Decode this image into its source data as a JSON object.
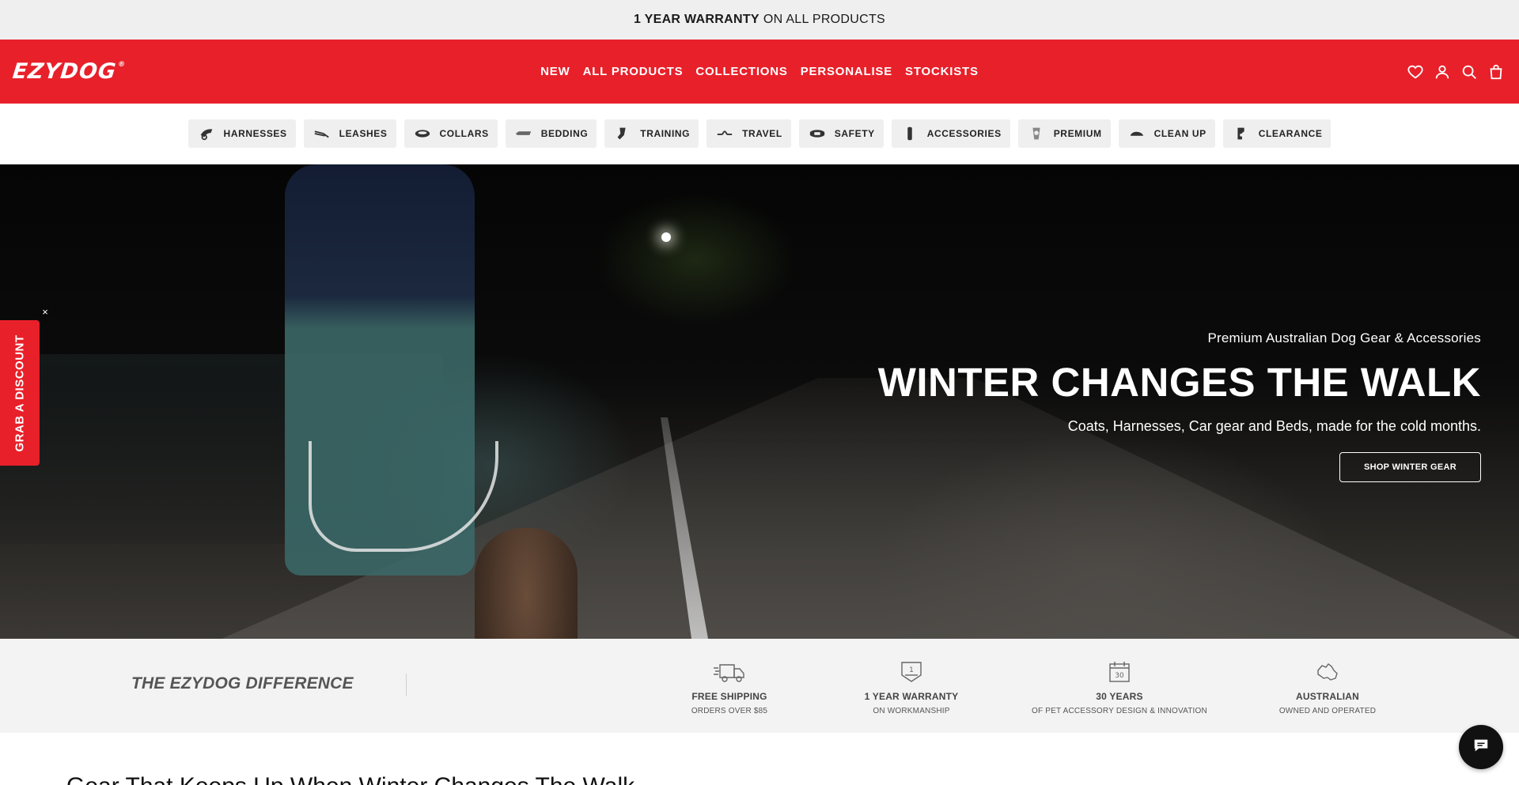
{
  "announcement": {
    "bold": "1 YEAR WARRANTY",
    "rest": "ON ALL PRODUCTS"
  },
  "header": {
    "logo": "EZYDOG",
    "logo_mark": "®",
    "nav": [
      "NEW",
      "ALL PRODUCTS",
      "COLLECTIONS",
      "PERSONALISE",
      "STOCKISTS"
    ],
    "icons": [
      "heart-icon",
      "account-icon",
      "search-icon",
      "bag-icon"
    ],
    "brand_color": "#e8202a"
  },
  "categories": [
    {
      "label": "HARNESSES",
      "icon": "harness-icon"
    },
    {
      "label": "LEASHES",
      "icon": "leash-icon"
    },
    {
      "label": "COLLARS",
      "icon": "collar-icon"
    },
    {
      "label": "BEDDING",
      "icon": "bed-icon"
    },
    {
      "label": "TRAINING",
      "icon": "training-icon"
    },
    {
      "label": "TRAVEL",
      "icon": "travel-icon"
    },
    {
      "label": "SAFETY",
      "icon": "safety-icon"
    },
    {
      "label": "ACCESSORIES",
      "icon": "accessories-icon"
    },
    {
      "label": "PREMIUM",
      "icon": "premium-icon"
    },
    {
      "label": "CLEAN UP",
      "icon": "cleanup-icon"
    },
    {
      "label": "CLEARANCE",
      "icon": "clearance-icon"
    }
  ],
  "hero": {
    "kicker": "Premium Australian Dog Gear & Accessories",
    "title": "WINTER CHANGES THE WALK",
    "subtitle": "Coats, Harnesses, Car gear and Beds, made for the cold months.",
    "button": "SHOP WINTER GEAR"
  },
  "discount_tab": {
    "label": "GRAB A DISCOUNT",
    "close": "×"
  },
  "difference": {
    "title": "THE EZYDOG DIFFERENCE",
    "features": [
      {
        "title": "FREE SHIPPING",
        "sub": "ORDERS OVER $85",
        "icon": "truck-icon"
      },
      {
        "title": "1 YEAR WARRANTY",
        "sub": "ON WORKMANSHIP",
        "icon": "warranty-badge-icon"
      },
      {
        "title": "30 YEARS",
        "sub": "OF PET ACCESSORY DESIGN & INNOVATION",
        "icon": "calendar-30-icon"
      },
      {
        "title": "AUSTRALIAN",
        "sub": "OWNED AND OPERATED",
        "icon": "australia-map-icon"
      }
    ]
  },
  "section_heading": "Gear That Keeps Up When Winter Changes The Walk",
  "chat": {
    "icon": "chat-icon"
  }
}
